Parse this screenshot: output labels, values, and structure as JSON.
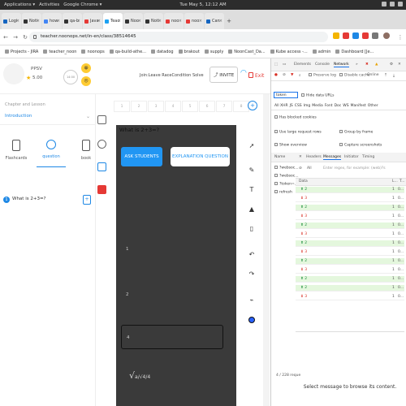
{
  "os": {
    "applications": "Applications ▾",
    "activities": "Activities",
    "chrome": "Google Chrome ▾",
    "clock": "Tue May 5, 12:12 AM"
  },
  "tabs": [
    {
      "label": "Logi",
      "color": "#1565c0"
    },
    {
      "label": "Noti",
      "color": "#333333"
    },
    {
      "label": "how",
      "color": "#4285f4"
    },
    {
      "label": "qa-b",
      "color": "#333333"
    },
    {
      "label": "Java",
      "color": "#e53935"
    },
    {
      "label": "Teac",
      "color": "#1da1f2"
    },
    {
      "label": "Noo",
      "color": "#333333"
    },
    {
      "label": "Noti",
      "color": "#333333"
    },
    {
      "label": "noo",
      "color": "#e53935"
    },
    {
      "label": "noo",
      "color": "#e53935"
    },
    {
      "label": "Can",
      "color": "#1565c0"
    }
  ],
  "address": {
    "url": "teacher.noonops.net/in-en/class/38514645"
  },
  "bookmarks": [
    "Projects - JIRA",
    "teacher_noon",
    "noonops",
    "qa-build-athe...",
    "datadog",
    "brakout",
    "supply",
    "NoonCast_Da...",
    "Kube access -...",
    "admin",
    "Dashboard [Je..."
  ],
  "header": {
    "teacher_name": "PPSV",
    "score": "5.00",
    "timer": "14:00",
    "status": "Join:Leave RaceCondition Solve",
    "invite": "INVITE",
    "exit": "Exit"
  },
  "sidebar": {
    "chapter_label": "Chapter and Lesson",
    "chapter_value": "Introduction",
    "tabs": [
      "Flashcards",
      "question",
      "book"
    ],
    "question_number": "1",
    "question_text": "What is 2+3=?"
  },
  "slides": [
    "1",
    "2",
    "3",
    "4",
    "5",
    "6",
    "7",
    "8"
  ],
  "board": {
    "question_title": "What is 2+3=?",
    "ask_students": "ASK STUDENTS",
    "explanation": "EXPLANATION QUESTION",
    "options": [
      "1",
      "2",
      "4"
    ],
    "sqrt_text": "a/√4/4"
  },
  "devtools": {
    "tabs": [
      "Elements",
      "Console",
      "Network"
    ],
    "preserve_log": "Preserve log",
    "disable_cache": "Disable cache",
    "online": "Online",
    "filter_value": "token",
    "hide_data_urls": "Hide data URLs",
    "filter_types": [
      "XHR",
      "JS",
      "CSS",
      "Img",
      "Media",
      "Font",
      "Doc",
      "WS",
      "Manifest",
      "Other"
    ],
    "blocked_cookies": "Has blocked cookies",
    "large_rows": "Use large request rows",
    "group_frame": "Group by frame",
    "overview": "Show overview",
    "screenshots": "Capture screenshots",
    "name_header": "Name",
    "sub_tabs": [
      "Headers",
      "Messages",
      "Initiator",
      "Timing"
    ],
    "msg_filter": "All",
    "msg_placeholder": "Enter regex, for example: (web)?s",
    "requests": [
      "?websoc...",
      "?websoc...",
      "?token=...",
      "refresh"
    ],
    "col_data": "Data",
    "col_len": "L...",
    "col_time": "T...",
    "messages": [
      {
        "dir": "up",
        "arrow": "⬆ 2",
        "len": "1",
        "time": "0..."
      },
      {
        "dir": "down",
        "arrow": "⬇ 3",
        "len": "1",
        "time": "0..."
      },
      {
        "dir": "up",
        "arrow": "⬆ 2",
        "len": "1",
        "time": "0..."
      },
      {
        "dir": "down",
        "arrow": "⬇ 3",
        "len": "1",
        "time": "0..."
      },
      {
        "dir": "up",
        "arrow": "⬆ 2",
        "len": "1",
        "time": "0..."
      },
      {
        "dir": "down",
        "arrow": "⬇ 3",
        "len": "1",
        "time": "0..."
      },
      {
        "dir": "up",
        "arrow": "⬆ 2",
        "len": "1",
        "time": "0..."
      },
      {
        "dir": "down",
        "arrow": "⬇ 3",
        "len": "1",
        "time": "0..."
      },
      {
        "dir": "up",
        "arrow": "⬆ 2",
        "len": "1",
        "time": "0..."
      },
      {
        "dir": "down",
        "arrow": "⬇ 3",
        "len": "1",
        "time": "0..."
      },
      {
        "dir": "up",
        "arrow": "⬆ 2",
        "len": "1",
        "time": "0..."
      },
      {
        "dir": "up",
        "arrow": "⬆ 2",
        "len": "1",
        "time": "0..."
      },
      {
        "dir": "down",
        "arrow": "⬇ 3",
        "len": "1",
        "time": "0..."
      }
    ],
    "empty_message": "Select message to browse its content.",
    "footer": "4 / 228 reque"
  }
}
